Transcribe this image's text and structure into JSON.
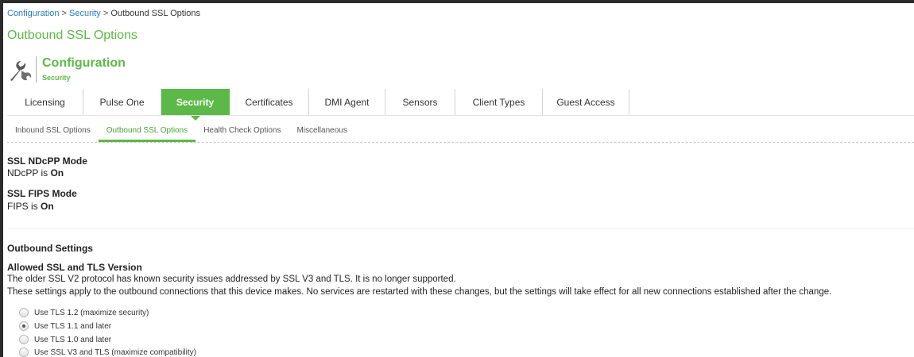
{
  "breadcrumb": {
    "items": [
      "Configuration",
      "Security"
    ],
    "separator": ">",
    "current": "Outbound SSL Options"
  },
  "page_title": "Outbound SSL Options",
  "header": {
    "title": "Configuration",
    "subtitle": "Security",
    "icon": "wrench-icon"
  },
  "tabs": [
    {
      "label": "Licensing",
      "active": false
    },
    {
      "label": "Pulse One",
      "active": false
    },
    {
      "label": "Security",
      "active": true
    },
    {
      "label": "Certificates",
      "active": false
    },
    {
      "label": "DMI Agent",
      "active": false
    },
    {
      "label": "Sensors",
      "active": false
    },
    {
      "label": "Client Types",
      "active": false
    },
    {
      "label": "Guest Access",
      "active": false
    }
  ],
  "subtabs": [
    {
      "label": "Inbound SSL Options",
      "active": false
    },
    {
      "label": "Outbound SSL Options",
      "active": true
    },
    {
      "label": "Health Check Options",
      "active": false
    },
    {
      "label": "Miscellaneous",
      "active": false
    }
  ],
  "ndcpp": {
    "label": "SSL NDcPP Mode",
    "prefix": "NDcPP is",
    "state": "On"
  },
  "fips": {
    "label": "SSL FIPS Mode",
    "prefix": "FIPS is",
    "state": "On"
  },
  "outbound": {
    "heading": "Outbound Settings",
    "allowed_label": "Allowed SSL and TLS Version",
    "line1": "The older SSL V2 protocol has known security issues addressed by SSL V3 and TLS. It is no longer supported.",
    "line2": "These settings apply to the outbound connections that this device makes. No services are restarted with these changes, but the settings will take effect for all new connections established after the change.",
    "options": [
      {
        "label": "Use TLS 1.2 (maximize security)",
        "checked": false
      },
      {
        "label": "Use TLS 1.1 and later",
        "checked": true
      },
      {
        "label": "Use TLS 1.0 and later",
        "checked": false
      },
      {
        "label": "Use SSL V3 and TLS (maximize compatibility)",
        "checked": false
      }
    ]
  },
  "colors": {
    "accent": "#5cb947",
    "link": "#2a7ab8"
  }
}
